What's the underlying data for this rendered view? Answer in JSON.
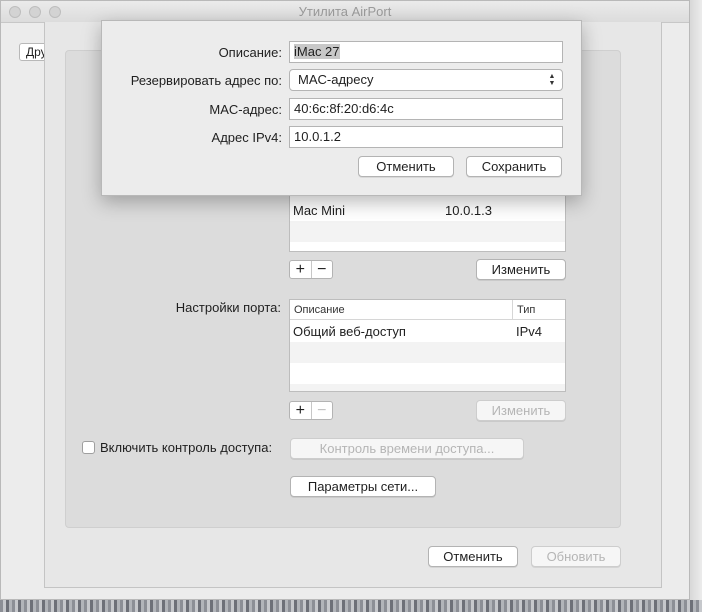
{
  "window": {
    "title": "Утилита AirPort",
    "side_button": "Другое"
  },
  "dialog": {
    "description_label": "Описание:",
    "description_value": "iMac 27",
    "reserve_label": "Резервировать адрес по:",
    "reserve_value": "MAC-адресу",
    "mac_label": "MAC-адрес:",
    "mac_value": "40:6c:8f:20:d6:4c",
    "ipv4_label": "Адрес IPv4:",
    "ipv4_value": "10.0.1.2",
    "cancel": "Отменить",
    "save": "Сохранить"
  },
  "reservations": {
    "rows": [
      {
        "name": "Mac Mini",
        "ip": "10.0.1.3"
      }
    ],
    "edit": "Изменить"
  },
  "ports": {
    "label": "Настройки порта:",
    "headers": {
      "description": "Описание",
      "type": "Тип"
    },
    "rows": [
      {
        "description": "Общий веб-доступ",
        "type": "IPv4"
      }
    ],
    "edit": "Изменить"
  },
  "access": {
    "checkbox_label": "Включить контроль доступа:",
    "checked": false,
    "timed_button": "Контроль времени доступа..."
  },
  "network_options": "Параметры сети...",
  "footer": {
    "cancel": "Отменить",
    "update": "Обновить"
  }
}
